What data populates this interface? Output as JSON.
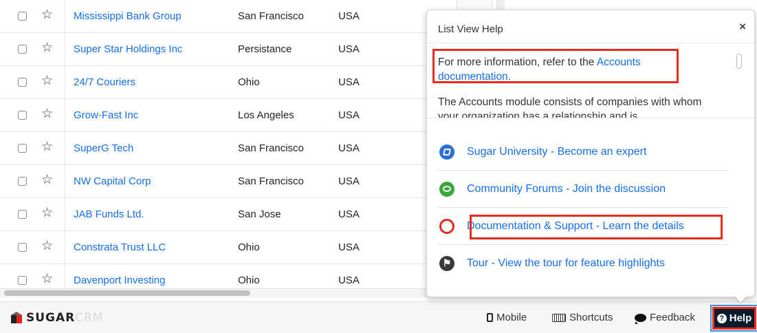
{
  "accounts": [
    {
      "name": "Mississippi Bank Group",
      "city": "San Francisco",
      "country": "USA"
    },
    {
      "name": "Super Star Holdings Inc",
      "city": "Persistance",
      "country": "USA"
    },
    {
      "name": "24/7 Couriers",
      "city": "Ohio",
      "country": "USA"
    },
    {
      "name": "Grow-Fast Inc",
      "city": "Los Angeles",
      "country": "USA"
    },
    {
      "name": "SuperG Tech",
      "city": "San Francisco",
      "country": "USA"
    },
    {
      "name": "NW Capital Corp",
      "city": "San Francisco",
      "country": "USA"
    },
    {
      "name": "JAB Funds Ltd.",
      "city": "San Jose",
      "country": "USA"
    },
    {
      "name": "Constrata Trust LLC",
      "city": "Ohio",
      "country": "USA"
    },
    {
      "name": "Davenport Investing",
      "city": "Ohio",
      "country": "USA"
    }
  ],
  "help": {
    "title": "List View Help",
    "close_icon": "×",
    "intro_prefix": "For more information, refer to the",
    "intro_link": "Accounts documentation.",
    "description": "The Accounts module consists of companies with whom your organization has a relationship and is",
    "links": [
      {
        "label": "Sugar University - Become an expert",
        "icon": "book-icon"
      },
      {
        "label": "Community Forums - Join the discussion",
        "icon": "chat-bubble-icon"
      },
      {
        "label": "Documentation & Support - Learn the details",
        "icon": "info-icon"
      },
      {
        "label": "Tour - View the tour for feature highlights",
        "icon": "tour-icon"
      }
    ]
  },
  "footer": {
    "logo_part1": "SUGAR",
    "logo_part2": "CRM",
    "mobile": "Mobile",
    "shortcuts": "Shortcuts",
    "feedback": "Feedback",
    "help": "Help"
  },
  "colors": {
    "link": "#176de5",
    "highlight": "#e8291c",
    "help_button": "#0b1c2c"
  }
}
